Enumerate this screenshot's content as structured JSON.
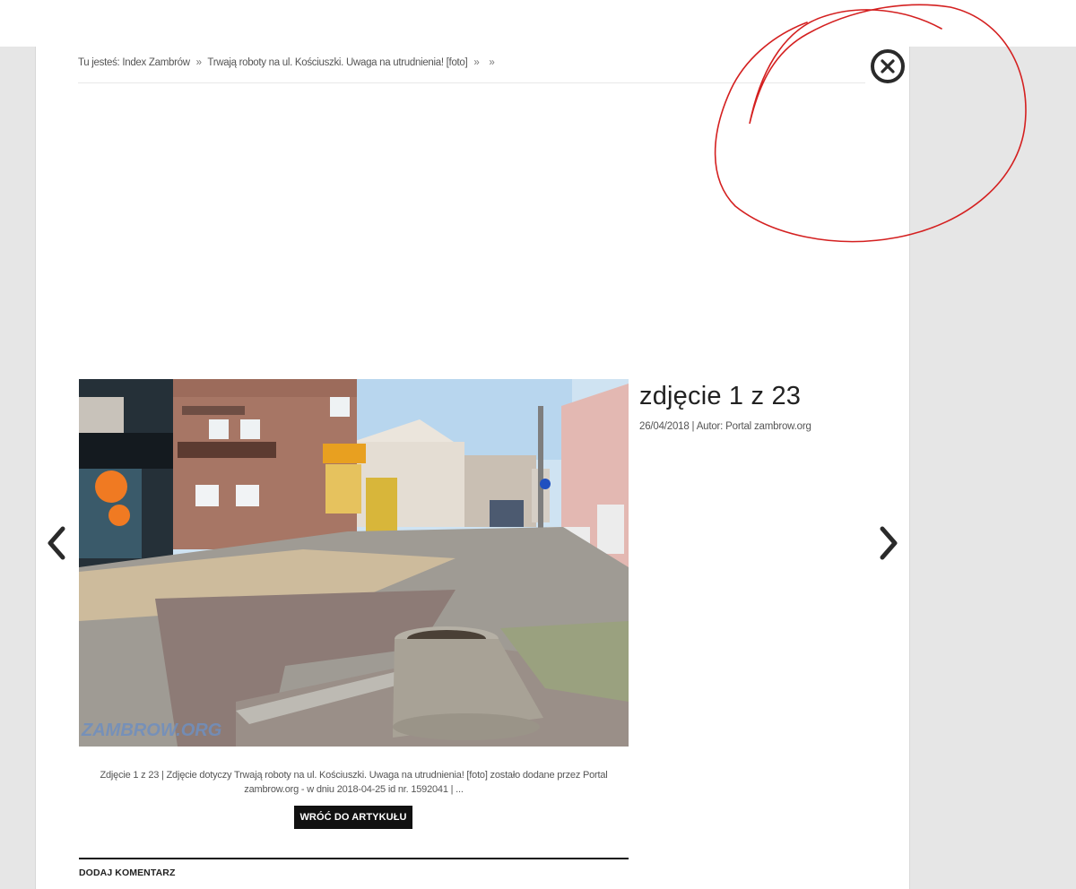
{
  "breadcrumb": {
    "prefix": "Tu jesteś:",
    "items": [
      "Index Zambrów",
      "Trwają roboty na ul. Kościuszki. Uwaga na utrudnienia! [foto]",
      ""
    ],
    "separator": "»"
  },
  "gallery": {
    "title": "zdjęcie 1 z 23",
    "meta": "26/04/2018 | Autor: Portal zambrow.org",
    "watermark": "ZAMBROW.ORG",
    "caption": "Zdjęcie 1 z 23 | Zdjęcie dotyczy Trwają roboty na ul. Kościuszki. Uwaga na utrudnienia! [foto] zostało dodane przez Portal zambrow.org - w dniu 2018-04-25 id nr. 1592041 | ...",
    "back_label": "WRÓĆ DO ARTYKUŁU"
  },
  "comments": {
    "title": "DODAJ KOMENTARZ"
  },
  "icons": {
    "close": "close-icon",
    "prev": "chevron-left-icon",
    "next": "chevron-right-icon"
  },
  "colors": {
    "background": "#e6e6e6",
    "annotation": "#d42020",
    "button": "#111111"
  }
}
